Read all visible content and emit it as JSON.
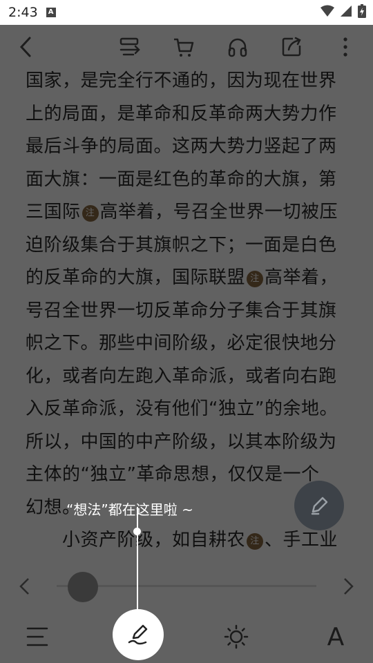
{
  "status": {
    "time": "2:43",
    "a_label": "A"
  },
  "lines": [
    "国家，是完全行不通的，因为现在世界",
    "上的局面，是革命和反革命两大势力作",
    "最后斗争的局面。这两大势力竖起了两",
    "面大旗：一面是红色的革命的大旗，第",
    [
      "三国际",
      "注",
      "高举着，号召全世界一切被压"
    ],
    "迫阶级集合于其旗帜之下；一面是白色",
    [
      "的反革命的大旗，国际联盟",
      "注",
      "高举着，"
    ],
    "号召全世界一切反革命分子集合于其旗",
    "帜之下。那些中间阶级，必定很快地分",
    "化，或者向左跑入革命派，或者向右跑",
    "入反革命派，没有他们“独立”的余地。",
    "所以，中国的中产阶级，以其本阶级为",
    "主体的“独立”革命思想，仅仅是一个",
    "幻想。",
    [
      "　　小资产阶级，如自耕农",
      "注",
      "、手工业"
    ]
  ],
  "tip": "“想法”都在这里啦 ~",
  "icons": {
    "back": "back-icon",
    "switch": "switch-source-icon",
    "cart": "cart-icon",
    "audio": "headphones-icon",
    "share": "share-icon",
    "more": "more-icon",
    "edit": "edit-icon",
    "menu": "menu-icon",
    "pen": "pen-icon",
    "brightness": "brightness-icon",
    "font": "font-icon"
  },
  "font_label": "A"
}
